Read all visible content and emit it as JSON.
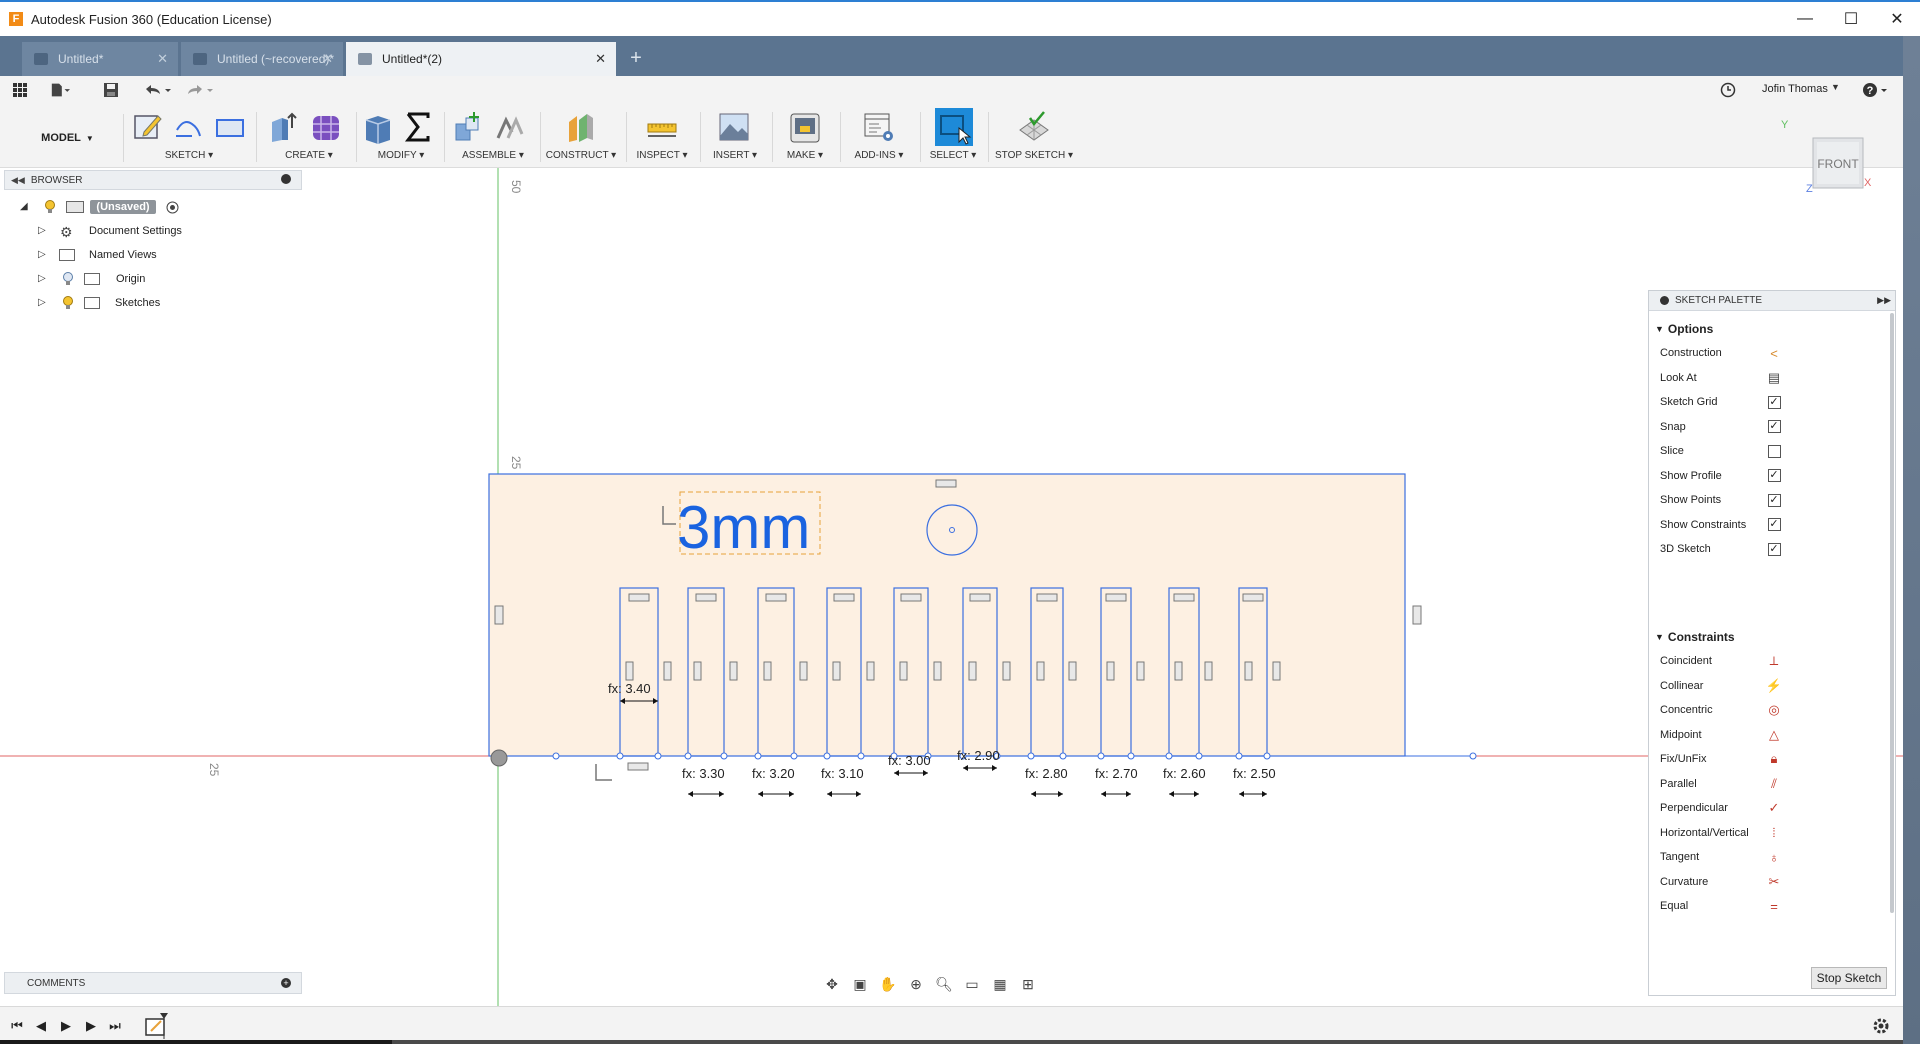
{
  "window": {
    "title": "Autodesk Fusion 360 (Education License)",
    "minimize": "—",
    "maximize": "☐",
    "close": "✕"
  },
  "tabs": [
    {
      "label": "Untitled*",
      "active": false
    },
    {
      "label": "Untitled (~recovered)*",
      "active": false
    },
    {
      "label": "Untitled*(2)",
      "active": true
    }
  ],
  "new_tab": "+",
  "user": {
    "name": "Jofin Thomas",
    "help": "?"
  },
  "toolbar": {
    "workspace": "MODEL",
    "groups": [
      {
        "id": "sketch",
        "label": "SKETCH"
      },
      {
        "id": "create",
        "label": "CREATE"
      },
      {
        "id": "modify",
        "label": "MODIFY"
      },
      {
        "id": "assemble",
        "label": "ASSEMBLE"
      },
      {
        "id": "construct",
        "label": "CONSTRUCT"
      },
      {
        "id": "inspect",
        "label": "INSPECT"
      },
      {
        "id": "insert",
        "label": "INSERT"
      },
      {
        "id": "make",
        "label": "MAKE"
      },
      {
        "id": "addins",
        "label": "ADD-INS"
      },
      {
        "id": "select",
        "label": "SELECT"
      },
      {
        "id": "stopsketch",
        "label": "STOP SKETCH"
      }
    ]
  },
  "browser": {
    "title": "BROWSER",
    "root": "(Unsaved)",
    "items": [
      {
        "label": "Document Settings"
      },
      {
        "label": "Named Views"
      },
      {
        "label": "Origin"
      },
      {
        "label": "Sketches"
      }
    ]
  },
  "viewcube": {
    "face": "FRONT",
    "axis_y": "Y",
    "axis_x": "X",
    "axis_z": "Z"
  },
  "canvas": {
    "ruler_labels": [
      "50",
      "25",
      "25"
    ],
    "sketch_text": "3mm",
    "dimensions": [
      "fx: 3.40",
      "fx: 3.30",
      "fx: 3.20",
      "fx: 3.10",
      "fx: 3.00",
      "fx: 2.90",
      "fx: 2.80",
      "fx: 2.70",
      "fx: 2.60",
      "fx: 2.50"
    ]
  },
  "palette": {
    "title": "SKETCH PALETTE",
    "options_title": "Options",
    "options": [
      {
        "label": "Construction",
        "type": "icon",
        "icon": "construction-icon"
      },
      {
        "label": "Look At",
        "type": "icon",
        "icon": "look-at-icon"
      },
      {
        "label": "Sketch Grid",
        "type": "check",
        "checked": true
      },
      {
        "label": "Snap",
        "type": "check",
        "checked": true
      },
      {
        "label": "Slice",
        "type": "check",
        "checked": false
      },
      {
        "label": "Show Profile",
        "type": "check",
        "checked": true
      },
      {
        "label": "Show Points",
        "type": "check",
        "checked": true
      },
      {
        "label": "Show Constraints",
        "type": "check",
        "checked": true
      },
      {
        "label": "3D Sketch",
        "type": "check",
        "checked": true
      }
    ],
    "constraints_title": "Constraints",
    "constraints": [
      {
        "label": "Coincident",
        "icon": "coincident-icon"
      },
      {
        "label": "Collinear",
        "icon": "collinear-icon"
      },
      {
        "label": "Concentric",
        "icon": "concentric-icon"
      },
      {
        "label": "Midpoint",
        "icon": "midpoint-icon"
      },
      {
        "label": "Fix/UnFix",
        "icon": "lock-icon"
      },
      {
        "label": "Parallel",
        "icon": "parallel-icon"
      },
      {
        "label": "Perpendicular",
        "icon": "perpendicular-icon"
      },
      {
        "label": "Horizontal/Vertical",
        "icon": "horizontal-vertical-icon"
      },
      {
        "label": "Tangent",
        "icon": "tangent-icon"
      },
      {
        "label": "Curvature",
        "icon": "curvature-icon"
      },
      {
        "label": "Equal",
        "icon": "equal-icon"
      }
    ],
    "stop_button": "Stop Sketch"
  },
  "comments": {
    "title": "COMMENTS"
  },
  "colors": {
    "accent": "#2d7fd3",
    "sketch_line": "#3b6fe0",
    "profile_fill": "#fdf0e2",
    "x_axis": "#e06666",
    "y_axis": "#66c266"
  }
}
